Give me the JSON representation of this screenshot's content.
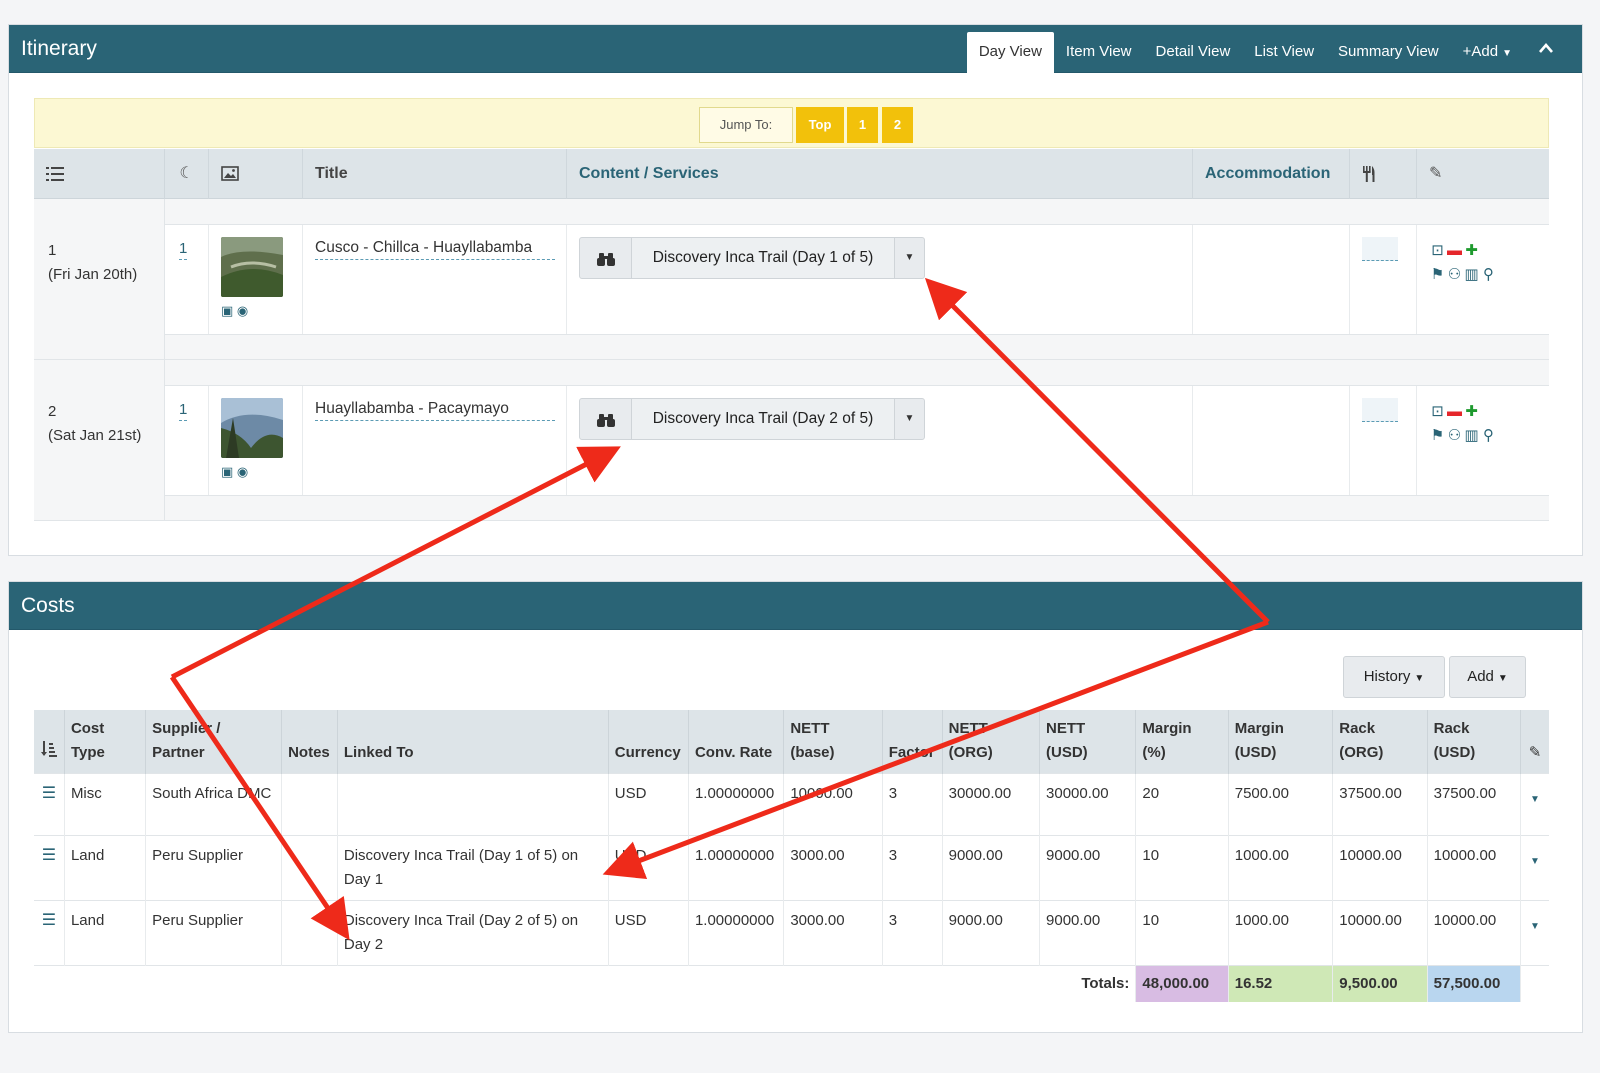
{
  "itinerary": {
    "title": "Itinerary",
    "tabs": [
      "Day View",
      "Item View",
      "Detail View",
      "List View",
      "Summary View"
    ],
    "add_label": "+Add",
    "jump": {
      "label": "Jump To:",
      "top": "Top",
      "one": "1",
      "two": "2"
    },
    "headers": {
      "title": "Title",
      "content": "Content / Services",
      "accommodation": "Accommodation"
    },
    "days": [
      {
        "day": "1",
        "date": "(Fri Jan 20th)",
        "nights": "1",
        "title": "Cusco - Chillca - Huayllabamba",
        "service": "Discovery Inca Trail (Day 1 of 5)"
      },
      {
        "day": "2",
        "date": "(Sat Jan 21st)",
        "nights": "1",
        "title": "Huayllabamba - Pacaymayo",
        "service": "Discovery Inca Trail (Day 2 of 5)"
      }
    ]
  },
  "costs": {
    "title": "Costs",
    "history_label": "History",
    "add_label": "Add",
    "headers": {
      "cost_type_1": "Cost",
      "cost_type_2": "Type",
      "supplier_1": "Supplier /",
      "supplier_2": "Partner",
      "notes": "Notes",
      "linked_to": "Linked To",
      "currency": "Currency",
      "conv_rate": "Conv. Rate",
      "nett_base_1": "NETT",
      "nett_base_2": "(base)",
      "factor": "Factor",
      "nett_org_1": "NETT",
      "nett_org_2": "(ORG)",
      "nett_usd_1": "NETT",
      "nett_usd_2": "(USD)",
      "margin_pct_1": "Margin",
      "margin_pct_2": "(%)",
      "margin_usd_1": "Margin",
      "margin_usd_2": "(USD)",
      "rack_org_1": "Rack",
      "rack_org_2": "(ORG)",
      "rack_usd_1": "Rack",
      "rack_usd_2": "(USD)"
    },
    "rows": [
      {
        "type": "Misc",
        "supplier": "South Africa DMC",
        "notes": "",
        "linked": "",
        "currency": "USD",
        "conv": "1.00000000",
        "nett_base": "10000.00",
        "factor": "3",
        "nett_org": "30000.00",
        "nett_usd": "30000.00",
        "margin_pct": "20",
        "margin_usd": "7500.00",
        "rack_org": "37500.00",
        "rack_usd": "37500.00"
      },
      {
        "type": "Land",
        "supplier": "Peru Supplier",
        "notes": "",
        "linked": "Discovery Inca Trail (Day 1 of 5) on Day 1",
        "currency": "USD",
        "conv": "1.00000000",
        "nett_base": "3000.00",
        "factor": "3",
        "nett_org": "9000.00",
        "nett_usd": "9000.00",
        "margin_pct": "10",
        "margin_usd": "1000.00",
        "rack_org": "10000.00",
        "rack_usd": "10000.00"
      },
      {
        "type": "Land",
        "supplier": "Peru Supplier",
        "notes": "",
        "linked": "Discovery Inca Trail (Day 2 of 5) on Day 2",
        "currency": "USD",
        "conv": "1.00000000",
        "nett_base": "3000.00",
        "factor": "3",
        "nett_org": "9000.00",
        "nett_usd": "9000.00",
        "margin_pct": "10",
        "margin_usd": "1000.00",
        "rack_org": "10000.00",
        "rack_usd": "10000.00"
      }
    ],
    "totals": {
      "label": "Totals:",
      "nett": "48,000.00",
      "margin": "16.52",
      "margin_usd": "9,500.00",
      "rack": "57,500.00"
    }
  },
  "colors": {
    "header": "#2a6476",
    "jump_yellow": "#f2c10b",
    "annotation": "#ee2a1a"
  }
}
